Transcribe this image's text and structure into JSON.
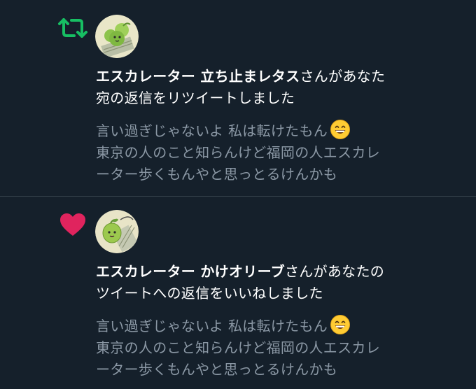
{
  "notifications": [
    {
      "type": "retweet",
      "icon": "retweet-icon",
      "icon_color": "#17bf63",
      "user_name": "エスカレーター 立ち止まレタス",
      "action_line1": "さんがあなた",
      "action_line2": "宛の返信をリツイートしました",
      "tweet_lines": [
        "言い過ぎじゃないよ 私は転けたもん",
        "東京の人のこと知らんけど福岡の人エスカレ",
        "ーター歩くもんやと思っとるけんかも"
      ],
      "emoji": "grinning-face-icon"
    },
    {
      "type": "like",
      "icon": "heart-icon",
      "icon_color": "#e0245e",
      "user_name": "エスカレーター かけオリーブ",
      "action_line1": "さんがあなたの",
      "action_line2": "ツイートへの返信をいいねしました",
      "tweet_lines": [
        "言い過ぎじゃないよ 私は転けたもん",
        "東京の人のこと知らんけど福岡の人エスカレ",
        "ーター歩くもんやと思っとるけんかも"
      ],
      "emoji": "grinning-face-icon"
    }
  ],
  "colors": {
    "background": "#15202b",
    "divider": "#38444d",
    "primary_text": "#ffffff",
    "secondary_text": "#8b98a5"
  }
}
